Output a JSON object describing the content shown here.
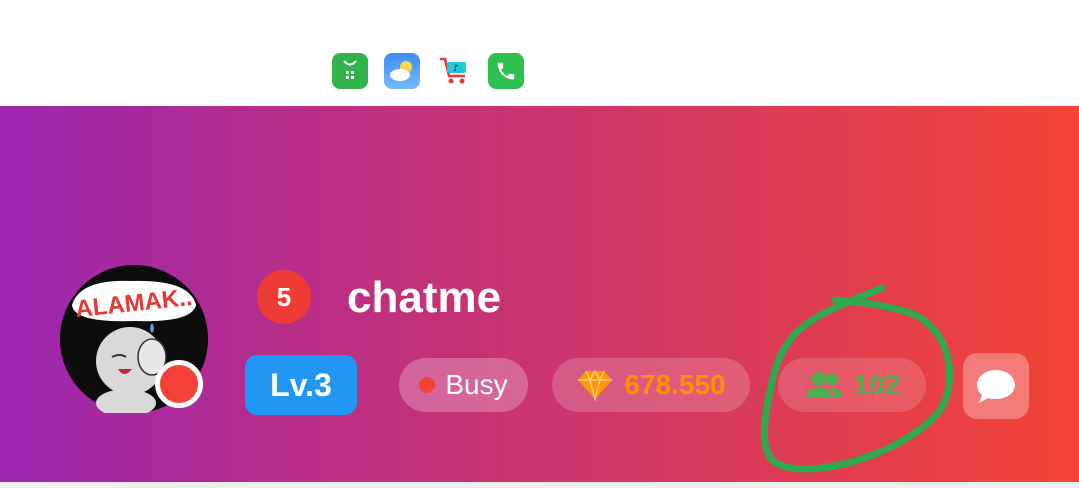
{
  "status_bar": {
    "app_icons": [
      {
        "name": "gift-app-icon"
      },
      {
        "name": "weather-app-icon"
      },
      {
        "name": "tiktok-shop-icon"
      },
      {
        "name": "phone-app-icon"
      }
    ]
  },
  "profile": {
    "avatar_text": "ALAMAK..",
    "rank": "5",
    "username": "chatme",
    "level": "Lv.3",
    "status": "Busy",
    "diamonds": "678.550",
    "friends": "102"
  },
  "colors": {
    "gradient_start": "#9c27b0",
    "gradient_end": "#f44336",
    "level_badge": "#2196f3",
    "diamond": "#ff8f00",
    "friends": "#4caf50",
    "annotation_circle": "#2fa84f"
  }
}
